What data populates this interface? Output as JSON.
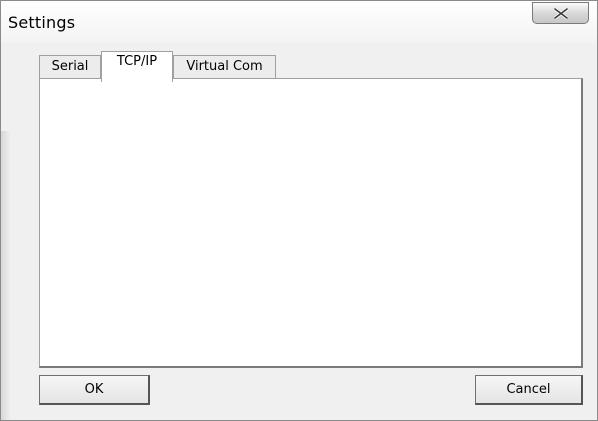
{
  "window": {
    "title": "Settings",
    "close_glyph": "✕"
  },
  "tabs": [
    {
      "label": "Serial",
      "selected": false
    },
    {
      "label": "TCP/IP",
      "selected": true
    },
    {
      "label": "Virtual Com",
      "selected": false
    }
  ],
  "buttons": {
    "ok_label": "OK",
    "cancel_label": "Cancel"
  },
  "icons": {
    "close": "close-icon"
  }
}
